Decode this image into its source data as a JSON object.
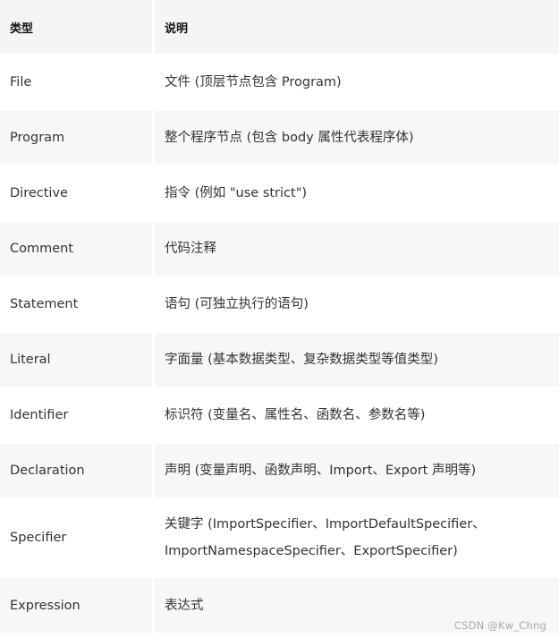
{
  "table": {
    "headers": [
      "类型",
      "说明"
    ],
    "rows": [
      {
        "type": "File",
        "desc": "文件 (顶层节点包含 Program)"
      },
      {
        "type": "Program",
        "desc": "整个程序节点 (包含 body 属性代表程序体)"
      },
      {
        "type": "Directive",
        "desc": "指令 (例如 \"use strict\")"
      },
      {
        "type": "Comment",
        "desc": "代码注释"
      },
      {
        "type": "Statement",
        "desc": "语句 (可独立执行的语句)"
      },
      {
        "type": "Literal",
        "desc": "字面量 (基本数据类型、复杂数据类型等值类型)"
      },
      {
        "type": "Identifier",
        "desc": "标识符 (变量名、属性名、函数名、参数名等)"
      },
      {
        "type": "Declaration",
        "desc": "声明 (变量声明、函数声明、Import、Export 声明等)"
      },
      {
        "type": "Specifier",
        "desc": "关键字 (ImportSpecifier、ImportDefaultSpecifier、ImportNamespaceSpecifier、ExportSpecifier)"
      },
      {
        "type": "Expression",
        "desc": "表达式"
      }
    ]
  },
  "watermark": "CSDN @Kw_Chng"
}
